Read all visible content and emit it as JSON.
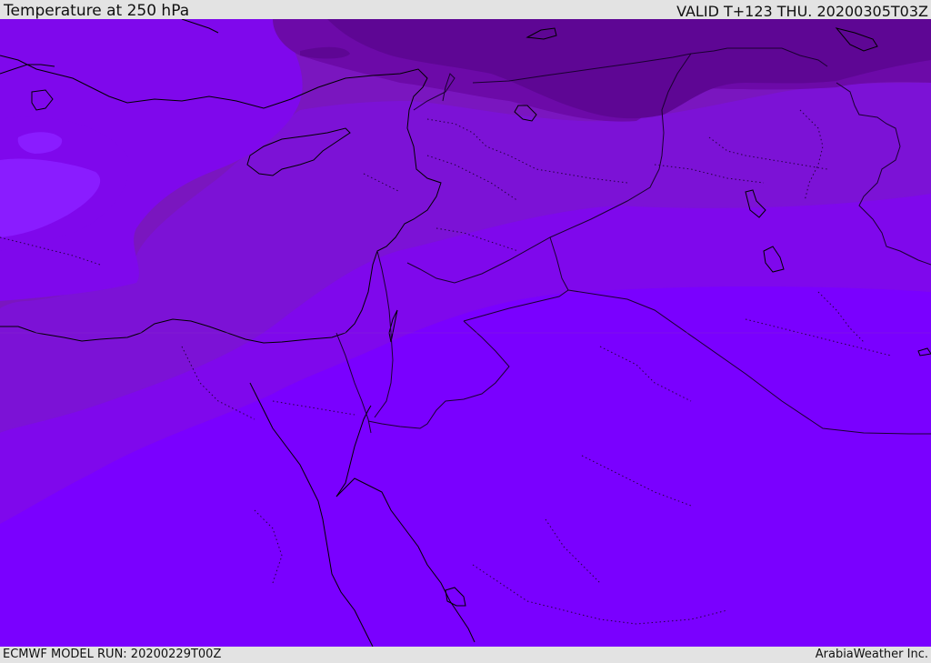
{
  "header": {
    "title": "Temperature at 250 hPa",
    "valid_time": "VALID T+123 THU. 20200305T03Z"
  },
  "footer": {
    "model_run": "ECMWF MODEL RUN: 20200229T00Z",
    "credit": "ArabiaWeather Inc."
  },
  "map": {
    "region": "Eastern Mediterranean / Levant / Arabian Peninsula",
    "colors": {
      "band_warmest": "#7a00ff",
      "band_1": "#7f08ec",
      "band_2": "#7c12d6",
      "band_3": "#7a16bf",
      "band_4": "#6c0aa8",
      "band_coldest": "#5e0694",
      "local_warm_spot": "#8a1cff",
      "coastline": "#000000",
      "borders": "#1a0030"
    }
  }
}
